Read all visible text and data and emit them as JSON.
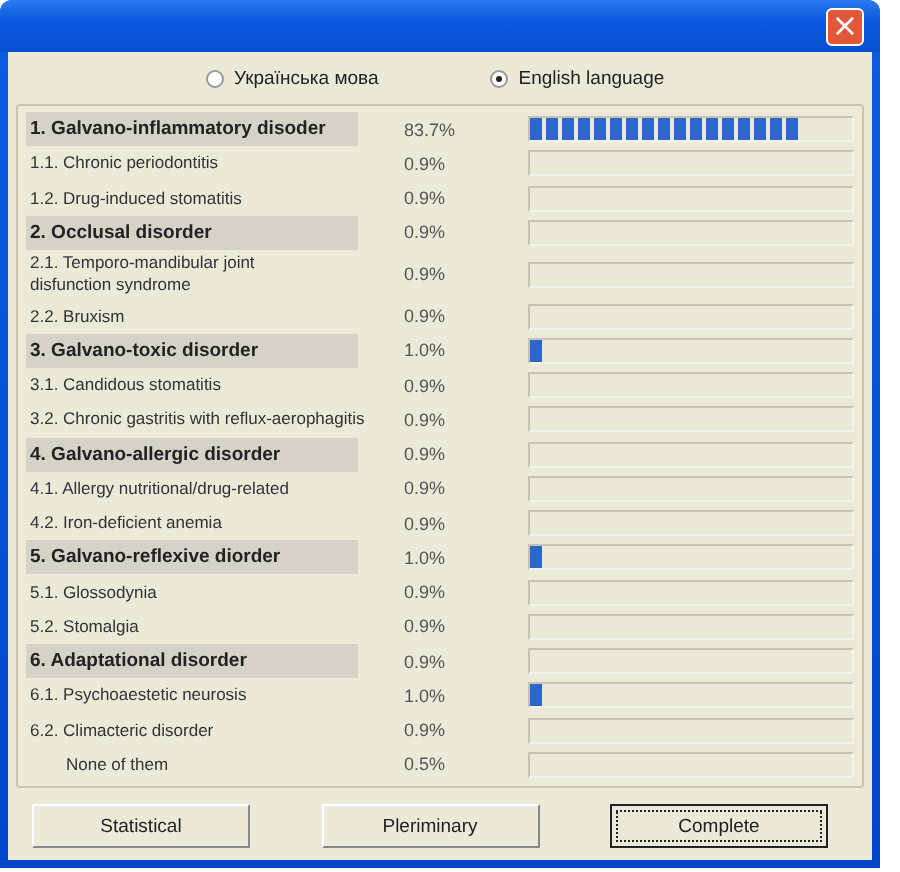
{
  "window": {
    "close_button": "×"
  },
  "languages": [
    {
      "label": "Українська мова",
      "selected": false
    },
    {
      "label": "English language",
      "selected": true
    }
  ],
  "rows": [
    {
      "kind": "header",
      "label": "1. Galvano-inflammatory disoder",
      "reading": "83.7%",
      "level": 0.84
    },
    {
      "kind": "item",
      "label": "1.1. Chronic periodontitis",
      "reading": "0.9%"
    },
    {
      "kind": "item",
      "label": "1.2. Drug-induced stomatitis",
      "reading": "0.9%"
    },
    {
      "kind": "header",
      "label": "2. Occlusal disorder",
      "reading": "0.9%"
    },
    {
      "kind": "item",
      "label": "2.1. Temporo-mandibular joint\ndisfunction syndrome",
      "reading": "0.9%"
    },
    {
      "kind": "item",
      "label": "2.2. Bruxism",
      "reading": "0.9%"
    },
    {
      "kind": "header",
      "label": "3. Galvano-toxic disorder",
      "reading": "1.0%",
      "level": 0.035
    },
    {
      "kind": "item",
      "label": "3.1. Candidous stomatitis",
      "reading": "0.9%"
    },
    {
      "kind": "item",
      "label": "3.2. Chronic gastritis with reflux-aerophagitis",
      "reading": "0.9%"
    },
    {
      "kind": "header",
      "label": "4. Galvano-allergic disorder",
      "reading": "0.9%"
    },
    {
      "kind": "item",
      "label": "4.1. Allergy nutritional/drug-related",
      "reading": "0.9%"
    },
    {
      "kind": "item",
      "label": "4.2. Iron-deficient anemia",
      "reading": "0.9%"
    },
    {
      "kind": "header",
      "label": "5. Galvano-reflexive diorder",
      "reading": "1.0%",
      "level": 0.035
    },
    {
      "kind": "item",
      "label": "5.1. Glossodynia",
      "reading": "0.9%"
    },
    {
      "kind": "item",
      "label": "5.2. Stomalgia",
      "reading": "0.9%"
    },
    {
      "kind": "header",
      "label": "6. Adaptational disorder",
      "reading": "0.9%"
    },
    {
      "kind": "item",
      "label": "6.1. Psychoaestetic neurosis",
      "reading": "1.0%",
      "level": 0.035
    },
    {
      "kind": "item",
      "label": "6.2. Climacteric disorder",
      "reading": "0.9%"
    },
    {
      "kind": "none",
      "label": "None of them",
      "reading": "0.5%"
    }
  ],
  "buttons": [
    {
      "label": "Statistical",
      "focused": false
    },
    {
      "label": "Pleriminary",
      "focused": false
    },
    {
      "label": "Complete",
      "focused": true
    }
  ]
}
